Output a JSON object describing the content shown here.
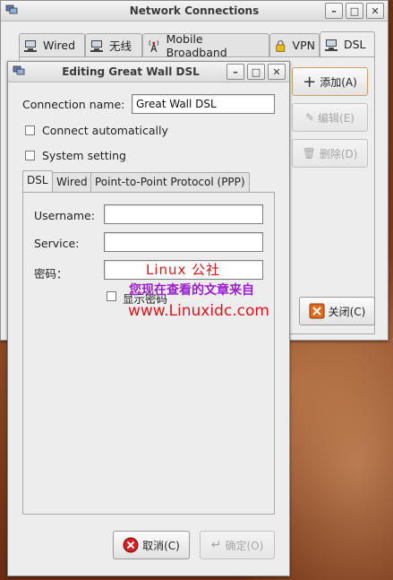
{
  "network_window": {
    "title": "Network Connections",
    "tabs": [
      {
        "label": "Wired"
      },
      {
        "label": "无线"
      },
      {
        "label": "Mobile Broadband"
      },
      {
        "label": "VPN"
      },
      {
        "label": "DSL"
      }
    ],
    "add_label": "添加(A)",
    "edit_label": "编辑(E)",
    "delete_label": "删除(D)",
    "close_label": "关闭(C)"
  },
  "edit_dialog": {
    "title": "Editing Great Wall DSL",
    "connection_name_label": "Connection name:",
    "connection_name_value": "Great Wall DSL",
    "connect_automatically_label": "Connect automatically",
    "system_setting_label": "System setting",
    "tabs": [
      {
        "label": "DSL"
      },
      {
        "label": "Wired"
      },
      {
        "label": "Point-to-Point Protocol (PPP)"
      }
    ],
    "dsl": {
      "username_label": "Username:",
      "username_value": "",
      "service_label": "Service:",
      "service_value": "",
      "password_label": "密码：",
      "password_value": "",
      "show_password_label": "显示密码"
    },
    "cancel_label": "取消(C)",
    "ok_label": "确定(O)"
  },
  "watermark": {
    "line1": "Linux 公社",
    "line2": "您现在查看的文章来自",
    "line3": "www.Linuxidc.com"
  }
}
